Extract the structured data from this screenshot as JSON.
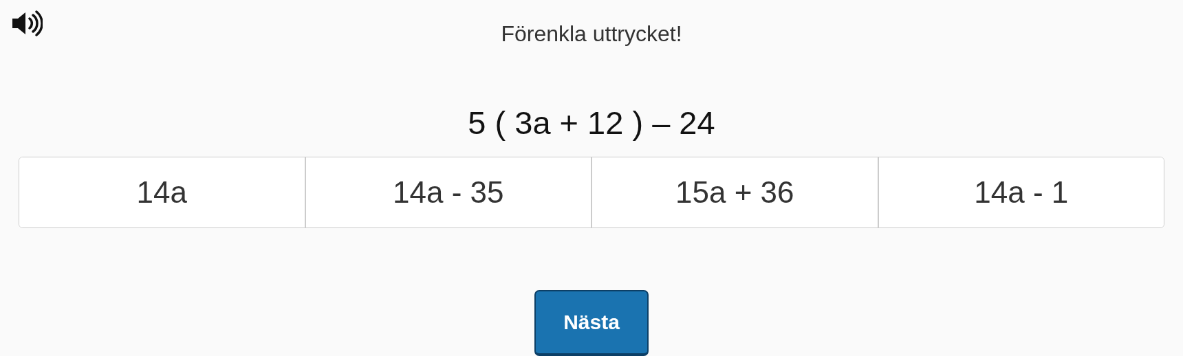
{
  "instruction": "Förenkla uttrycket!",
  "expression": "5 ( 3a + 12 ) – 24",
  "options": [
    {
      "label": "14a",
      "selected": false
    },
    {
      "label": "14a - 35",
      "selected": false
    },
    {
      "label": "15a + 36",
      "selected": false
    },
    {
      "label": "14a - 1",
      "selected": false
    }
  ],
  "next_button": "Nästa"
}
